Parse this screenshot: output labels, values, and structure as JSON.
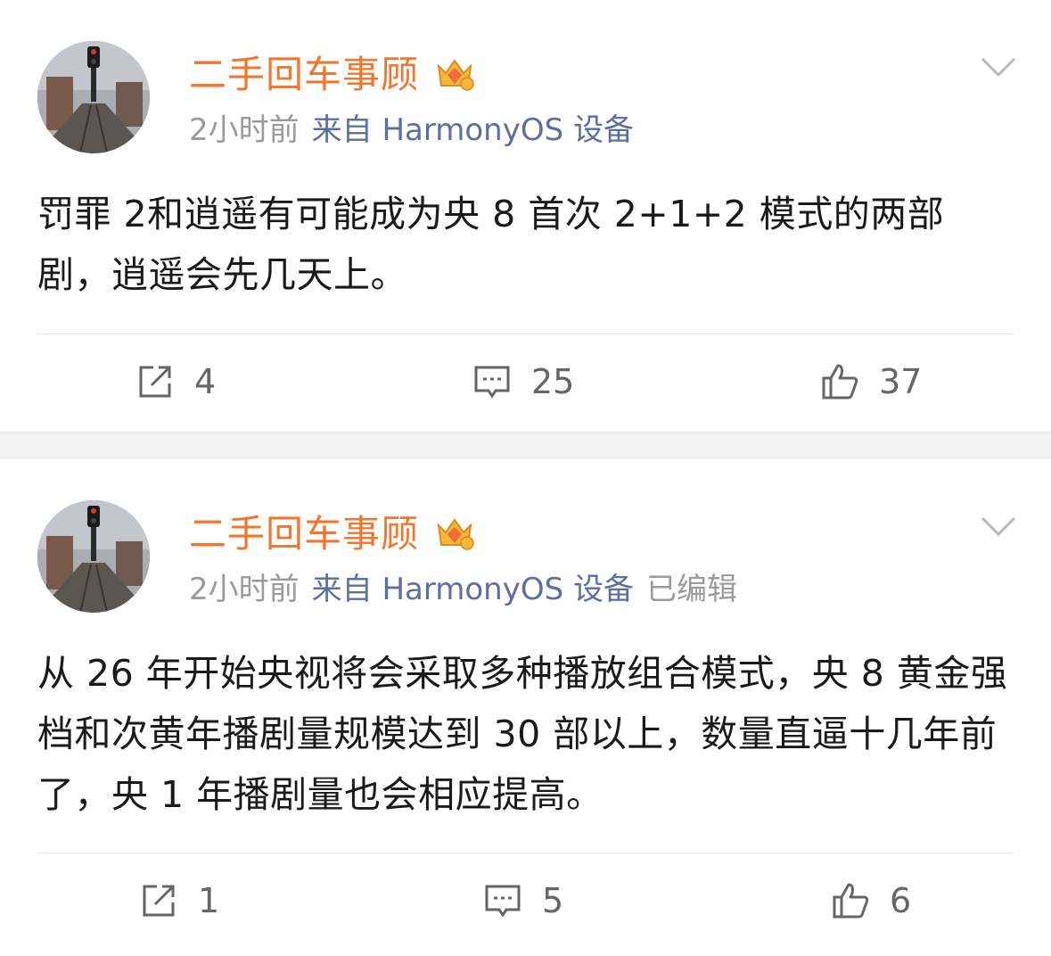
{
  "posts": [
    {
      "username": "二手回车事顾",
      "time": "2小时前",
      "source": "来自 HarmonyOS 设备",
      "edited": "",
      "content": "罚罪 2和逍遥有可能成为央 8 首次 2+1+2 模式的两部剧，逍遥会先几天上。",
      "reposts": "4",
      "comments": "25",
      "likes": "37"
    },
    {
      "username": "二手回车事顾",
      "time": "2小时前",
      "source": "来自 HarmonyOS 设备",
      "edited": "已编辑",
      "content": "从 26 年开始央视将会采取多种播放组合模式，央 8 黄金强档和次黄年播剧量规模达到 30 部以上，数量直逼十几年前了，央 1 年播剧量也会相应提高。",
      "reposts": "1",
      "comments": "5",
      "likes": "6"
    }
  ],
  "colors": {
    "username": "#f0772d",
    "source": "#5b6fa0",
    "meta": "#9a9a9a",
    "text": "#1a1a1a"
  },
  "icons": [
    "crown-badge-icon",
    "chevron-down-icon",
    "repost-icon",
    "comment-icon",
    "like-icon"
  ]
}
